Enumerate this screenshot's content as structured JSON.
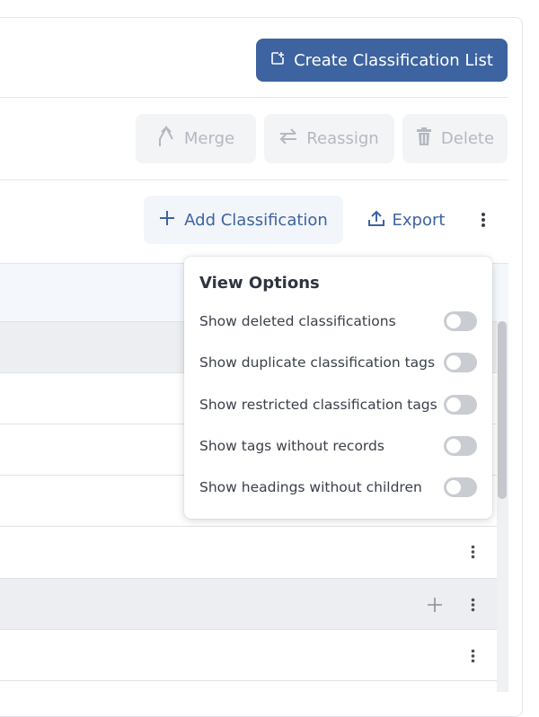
{
  "header": {
    "create_button_label": "Create Classification List"
  },
  "bulk_actions": {
    "merge_label": "Merge",
    "reassign_label": "Reassign",
    "delete_label": "Delete"
  },
  "toolbar": {
    "add_label": "Add Classification",
    "export_label": "Export"
  },
  "view_options": {
    "title": "View Options",
    "options": [
      {
        "label": "Show deleted classifications",
        "enabled": false
      },
      {
        "label": "Show duplicate classification tags",
        "enabled": false
      },
      {
        "label": "Show restricted classification tags",
        "enabled": false
      },
      {
        "label": "Show tags without records",
        "enabled": false
      },
      {
        "label": "Show headings without children",
        "enabled": false
      }
    ]
  },
  "colors": {
    "primary": "#3d63a0",
    "disabled_text": "#b3b8c0",
    "toggle_off": "#c9ccd1"
  }
}
